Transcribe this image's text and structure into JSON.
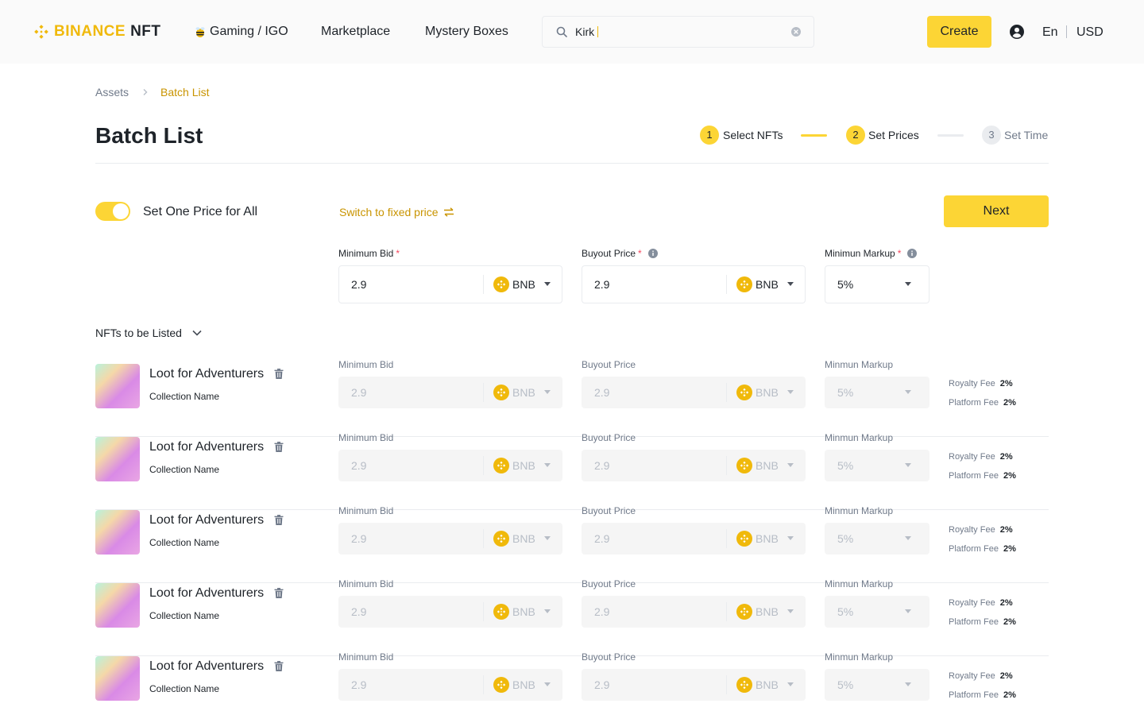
{
  "header": {
    "logo_brand": "BINANCE",
    "logo_suffix": "NFT",
    "nav": [
      "Gaming / IGO",
      "Marketplace",
      "Mystery Boxes"
    ],
    "search_value": "Kirk",
    "create_label": "Create",
    "language": "En",
    "currency": "USD"
  },
  "breadcrumb": {
    "parent": "Assets",
    "current": "Batch List"
  },
  "page": {
    "title": "Batch List"
  },
  "steps": [
    {
      "number": "1",
      "label": "Select NFTs",
      "state": "done"
    },
    {
      "number": "2",
      "label": "Set Prices",
      "state": "active"
    },
    {
      "number": "3",
      "label": "Set Time",
      "state": "pending"
    }
  ],
  "controls": {
    "toggle_label": "Set One Price for All",
    "toggle_on": true,
    "switch_link": "Switch to fixed price",
    "next_label": "Next"
  },
  "global_prices": {
    "minimum_bid": {
      "label": "Minimum Bid",
      "value": "2.9",
      "currency": "BNB"
    },
    "buyout_price": {
      "label": "Buyout Price",
      "value": "2.9",
      "currency": "BNB"
    },
    "minimum_markup": {
      "label": "Minimun Markup",
      "value": "5%"
    }
  },
  "nfts_section_label": "NFTs to be Listed",
  "row_labels": {
    "minimum_bid": "Minimum Bid",
    "buyout_price": "Buyout Price",
    "minimum_markup": "Minmun Markup",
    "royalty_fee": "Royalty Fee",
    "platform_fee": "Platform Fee"
  },
  "nfts": [
    {
      "name": "Loot for Adventurers",
      "collection": "Collection Name",
      "min_bid": "2.9",
      "min_bid_currency": "BNB",
      "buyout": "2.9",
      "buyout_currency": "BNB",
      "markup": "5%",
      "royalty": "2%",
      "platform": "2%"
    },
    {
      "name": "Loot for Adventurers",
      "collection": "Collection Name",
      "min_bid": "2.9",
      "min_bid_currency": "BNB",
      "buyout": "2.9",
      "buyout_currency": "BNB",
      "markup": "5%",
      "royalty": "2%",
      "platform": "2%"
    },
    {
      "name": "Loot for Adventurers",
      "collection": "Collection Name",
      "min_bid": "2.9",
      "min_bid_currency": "BNB",
      "buyout": "2.9",
      "buyout_currency": "BNB",
      "markup": "5%",
      "royalty": "2%",
      "platform": "2%"
    },
    {
      "name": "Loot for Adventurers",
      "collection": "Collection Name",
      "min_bid": "2.9",
      "min_bid_currency": "BNB",
      "buyout": "2.9",
      "buyout_currency": "BNB",
      "markup": "5%",
      "royalty": "2%",
      "platform": "2%"
    },
    {
      "name": "Loot for Adventurers",
      "collection": "Collection Name",
      "min_bid": "2.9",
      "min_bid_currency": "BNB",
      "buyout": "2.9",
      "buyout_currency": "BNB",
      "markup": "5%",
      "royalty": "2%",
      "platform": "2%"
    }
  ],
  "colors": {
    "brand_yellow": "#fcd535",
    "brand_gold": "#f0b90b",
    "link_gold": "#c99400",
    "required_red": "#f6465d",
    "text_primary": "#1e2329",
    "text_secondary": "#707a8a"
  }
}
